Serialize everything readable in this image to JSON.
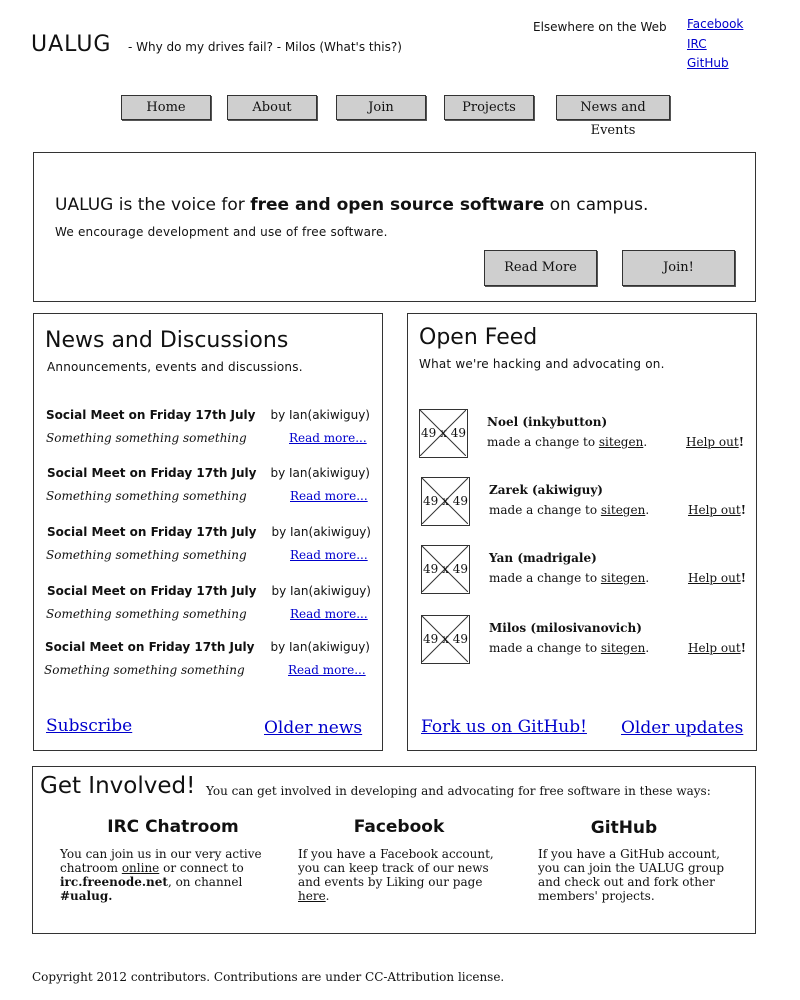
{
  "header": {
    "logo": "UALUG",
    "tagline": "- Why do my drives fail? - Milos (What's this?)",
    "elsewhere_label": "Elsewhere on the Web",
    "links": [
      "Facebook",
      "IRC",
      "GitHub"
    ]
  },
  "nav": [
    "Home",
    "About",
    "Join",
    "Projects",
    "News and Events"
  ],
  "hero": {
    "line_prefix": "UALUG is the voice for ",
    "line_bold": "free and open source software",
    "line_suffix": " on campus.",
    "sub": "We encourage development and use of free software.",
    "read_more": "Read More",
    "join": "Join!"
  },
  "news": {
    "title": "News and Discussions",
    "subtitle": "Announcements, events and discussions.",
    "items": [
      {
        "title": "Social Meet on Friday 17th July",
        "author": "by Ian(akiwiguy)",
        "excerpt": "Something something something",
        "link": "Read more..."
      },
      {
        "title": "Social Meet on Friday 17th July",
        "author": "by Ian(akiwiguy)",
        "excerpt": "Something something something",
        "link": "Read more..."
      },
      {
        "title": "Social Meet on Friday 17th July",
        "author": "by Ian(akiwiguy)",
        "excerpt": "Something something something",
        "link": "Read more..."
      },
      {
        "title": "Social Meet on Friday 17th July",
        "author": "by Ian(akiwiguy)",
        "excerpt": "Something something something",
        "link": "Read more..."
      },
      {
        "title": "Social Meet on Friday 17th July",
        "author": "by Ian(akiwiguy)",
        "excerpt": "Something something something",
        "link": "Read more..."
      }
    ],
    "subscribe": "Subscribe",
    "older": "Older news"
  },
  "feed": {
    "title": "Open Feed",
    "subtitle": "What we're hacking and advocating on.",
    "placeholder": "49 x 49",
    "items": [
      {
        "name": "Noel (inkybutton)",
        "action": "made a change to ",
        "target": "sitegen",
        "period": ".",
        "help": "Help out",
        "bang": "!"
      },
      {
        "name": "Zarek (akiwiguy)",
        "action": "made a change to ",
        "target": "sitegen",
        "period": ".",
        "help": "Help out",
        "bang": "!"
      },
      {
        "name": "Yan (madrigale)",
        "action": "made a change to ",
        "target": "sitegen",
        "period": ".",
        "help": "Help out",
        "bang": "!"
      },
      {
        "name": "Milos (milosivanovich)",
        "action": "made a change to ",
        "target": "sitegen",
        "period": ".",
        "help": "Help out",
        "bang": "!"
      }
    ],
    "fork": "Fork us on GitHub!",
    "older": "Older updates"
  },
  "involved": {
    "title": "Get Involved!",
    "intro": "You can get involved in developing and advocating for free software in these ways:",
    "irc": {
      "heading": "IRC Chatroom",
      "t1": "You can join us in our very active chatroom ",
      "link": "online",
      "t2": " or connect to ",
      "server": "irc.freenode.net",
      "t3": ", on channel ",
      "channel": "#ualug",
      "t4": "."
    },
    "facebook": {
      "heading": "Facebook",
      "t1": "If you have a Facebook account, you can keep track of our news and events by Liking our page ",
      "link": "here",
      "t2": "."
    },
    "github": {
      "heading": "GitHub",
      "t1": "If you have a GitHub account, you can join the UALUG group and check out and fork other members' projects."
    }
  },
  "footer": "Copyright 2012 contributors. Contributions are under CC-Attribution license."
}
